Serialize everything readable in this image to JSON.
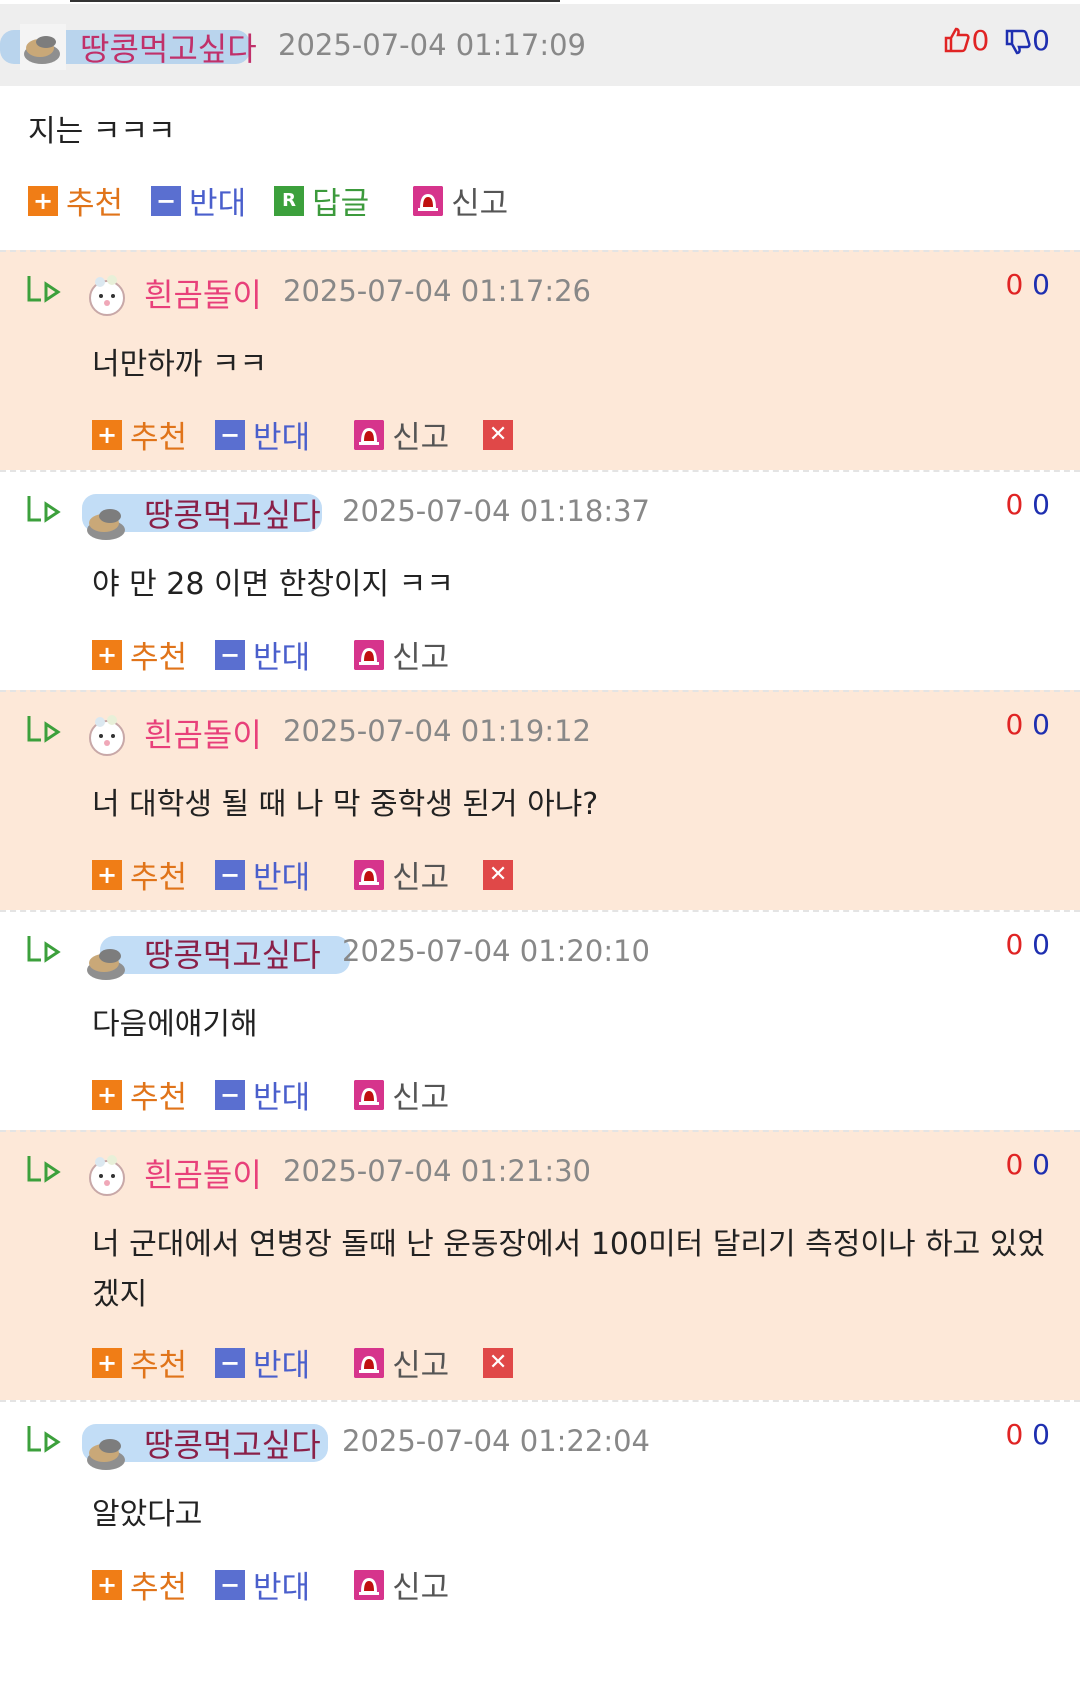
{
  "main": {
    "nickname": "땅콩먹고싶다",
    "time": "2025-07-04 01:17:09",
    "up": "0",
    "down": "0",
    "text": "지는 ㅋㅋㅋ",
    "actions": {
      "recommend": "추천",
      "oppose": "반대",
      "reply": "답글",
      "report": "신고"
    }
  },
  "replies": [
    {
      "nickname": "흰곰돌이",
      "time": "2025-07-04 01:17:26",
      "up": "0",
      "down": "0",
      "text": "너만하까 ㅋㅋ",
      "recommend": "추천",
      "oppose": "반대",
      "report": "신고"
    },
    {
      "nickname": "땅콩먹고싶다",
      "time": "2025-07-04 01:18:37",
      "up": "0",
      "down": "0",
      "text": "야 만 28 이면 한창이지 ㅋㅋ",
      "recommend": "추천",
      "oppose": "반대",
      "report": "신고"
    },
    {
      "nickname": "흰곰돌이",
      "time": "2025-07-04 01:19:12",
      "up": "0",
      "down": "0",
      "text": "너 대학생 될 때 나 막 중학생 된거 아냐?",
      "recommend": "추천",
      "oppose": "반대",
      "report": "신고"
    },
    {
      "nickname": "땅콩먹고싶다",
      "time": "2025-07-04 01:20:10",
      "up": "0",
      "down": "0",
      "text": "다음에얘기해",
      "recommend": "추천",
      "oppose": "반대",
      "report": "신고"
    },
    {
      "nickname": "흰곰돌이",
      "time": "2025-07-04 01:21:30",
      "up": "0",
      "down": "0",
      "text": "너 군대에서 연병장 돌때 난 운동장에서 100미터 달리기 측정이나 하고 있었겠지",
      "recommend": "추천",
      "oppose": "반대",
      "report": "신고"
    },
    {
      "nickname": "땅콩먹고싶다",
      "time": "2025-07-04 01:22:04",
      "up": "0",
      "down": "0",
      "text": "알았다고",
      "recommend": "추천",
      "oppose": "반대",
      "report": "신고"
    }
  ],
  "icons": {
    "reply_arrow": "reply-arrow-icon",
    "peanut_avatar": "peanut-avatar-icon",
    "bear_avatar": "bear-avatar-icon",
    "thumbs_up": "thumbs-up-icon",
    "thumbs_down": "thumbs-down-icon",
    "delete": "delete-icon",
    "report": "siren-icon"
  },
  "colors": {
    "peach_bg": "#fde8d8",
    "header_bg": "#eeeeee",
    "recommend": "#f07d16",
    "oppose": "#5a6fd0",
    "reply": "#3ca03c",
    "report": "#d6348c",
    "up": "#e02424",
    "down": "#1e2fb0"
  }
}
